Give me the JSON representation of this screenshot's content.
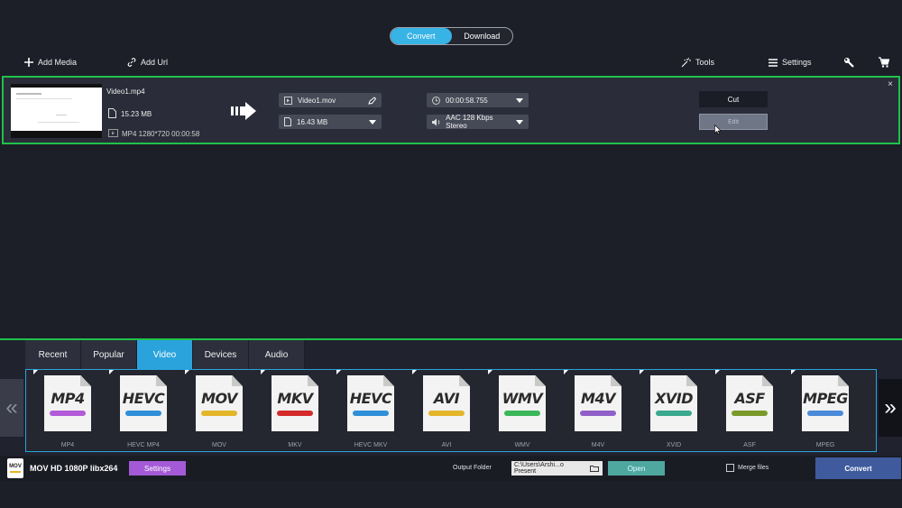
{
  "mode_tabs": {
    "convert": "Convert",
    "download": "Download"
  },
  "toolbar": {
    "add_media": "Add Media",
    "add_url": "Add Url",
    "tools": "Tools",
    "settings": "Settings"
  },
  "item": {
    "filename": "Video1.mp4",
    "size": "15.23 MB",
    "info": "MP4 1280*720 00:00:58",
    "output_name": "Video1.mov",
    "output_size": "16.43 MB",
    "duration": "00:00:58.755",
    "audio": "AAC 128 Kbps Stereo",
    "cut_label": "Cut",
    "edit_label": "Edit",
    "close_label": "×"
  },
  "category_tabs": [
    "Recent",
    "Popular",
    "Video",
    "Devices",
    "Audio"
  ],
  "active_category": "Video",
  "formats": [
    {
      "name": "MP4",
      "caption": "MP4",
      "pill_color": "#b25ad8"
    },
    {
      "name": "HEVC",
      "caption": "HEVC MP4",
      "pill_color": "#2f8fd8"
    },
    {
      "name": "MOV",
      "caption": "MOV",
      "pill_color": "#e3b528"
    },
    {
      "name": "MKV",
      "caption": "MKV",
      "pill_color": "#d42a2a"
    },
    {
      "name": "HEVC",
      "caption": "HEVC MKV",
      "pill_color": "#2f8fd8"
    },
    {
      "name": "AVI",
      "caption": "AVI",
      "pill_color": "#e3b528"
    },
    {
      "name": "WMV",
      "caption": "WMV",
      "pill_color": "#3bb75a"
    },
    {
      "name": "M4V",
      "caption": "M4V",
      "pill_color": "#9060c8"
    },
    {
      "name": "XVID",
      "caption": "XVID",
      "pill_color": "#3aa98e"
    },
    {
      "name": "ASF",
      "caption": "ASF",
      "pill_color": "#7a9a2a"
    },
    {
      "name": "MPEG",
      "caption": "MPEG",
      "pill_color": "#4a8ad8"
    }
  ],
  "nav": {
    "prev": "«",
    "next": "»"
  },
  "footer": {
    "preset_logo": "MOV",
    "preset_name": "MOV HD 1080P libx264",
    "settings_label": "Settings",
    "output_folder_label": "Output Folder",
    "output_path": "C:\\Users\\Arshi...o Present",
    "open_label": "Open",
    "merge_label": "Merge files",
    "convert_label": "Convert"
  },
  "colors": {
    "accent_blue": "#2aa3dd",
    "selection_green": "#1fc24a",
    "convert_button": "#3f5b9e",
    "settings_button": "#a45ad6",
    "open_button": "#4fa8a0"
  }
}
